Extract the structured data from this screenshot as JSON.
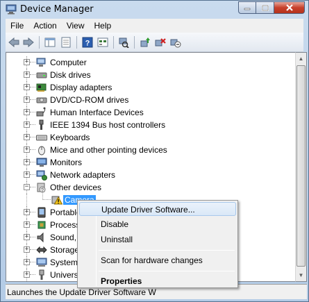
{
  "window": {
    "title": "Device Manager"
  },
  "menubar": {
    "items": [
      "File",
      "Action",
      "View",
      "Help"
    ]
  },
  "toolbar": {
    "buttons": [
      "back-arrow-icon",
      "forward-arrow-icon",
      "show-hide-console-tree-icon",
      "properties-icon",
      "help-icon",
      "view-icon",
      "scan-hardware-icon",
      "update-driver-icon",
      "uninstall-icon",
      "disable-icon"
    ]
  },
  "tree": {
    "items": [
      {
        "label": "Computer",
        "icon": "computer-icon",
        "expander": "+"
      },
      {
        "label": "Disk drives",
        "icon": "disk-drive-icon",
        "expander": "+"
      },
      {
        "label": "Display adapters",
        "icon": "display-adapter-icon",
        "expander": "+"
      },
      {
        "label": "DVD/CD-ROM drives",
        "icon": "dvd-drive-icon",
        "expander": "+"
      },
      {
        "label": "Human Interface Devices",
        "icon": "hid-icon",
        "expander": "+"
      },
      {
        "label": "IEEE 1394 Bus host controllers",
        "icon": "ieee1394-icon",
        "expander": "+"
      },
      {
        "label": "Keyboards",
        "icon": "keyboard-icon",
        "expander": "+"
      },
      {
        "label": "Mice and other pointing devices",
        "icon": "mouse-icon",
        "expander": "+"
      },
      {
        "label": "Monitors",
        "icon": "monitor-icon",
        "expander": "+"
      },
      {
        "label": "Network adapters",
        "icon": "network-adapter-icon",
        "expander": "+"
      },
      {
        "label": "Other devices",
        "icon": "other-devices-icon",
        "expander": "−"
      },
      {
        "label": "Camera",
        "icon": "warning-device-icon",
        "child": true,
        "selected": true
      },
      {
        "label": "Portable Devices",
        "icon": "portable-device-icon",
        "expander": "+"
      },
      {
        "label": "Processors",
        "icon": "processor-icon",
        "expander": "+"
      },
      {
        "label": "Sound, video and game controllers",
        "icon": "sound-icon",
        "expander": "+"
      },
      {
        "label": "Storage controllers",
        "icon": "storage-icon",
        "expander": "+"
      },
      {
        "label": "System devices",
        "icon": "system-device-icon",
        "expander": "+"
      },
      {
        "label": "Universal Serial Bus controllers",
        "icon": "usb-icon",
        "expander": "+"
      }
    ]
  },
  "context_menu": {
    "items": [
      {
        "label": "Update Driver Software...",
        "hover": true
      },
      {
        "label": "Disable"
      },
      {
        "label": "Uninstall"
      },
      {
        "separator": true
      },
      {
        "label": "Scan for hardware changes"
      },
      {
        "separator": true
      },
      {
        "label": "Properties",
        "bold": true
      }
    ]
  },
  "status": {
    "text": "Launches the Update Driver Software W"
  },
  "colors": {
    "selection": "#3399ff",
    "window_frame": "#b9d1ea",
    "menu_hover": "#dae8f7"
  }
}
